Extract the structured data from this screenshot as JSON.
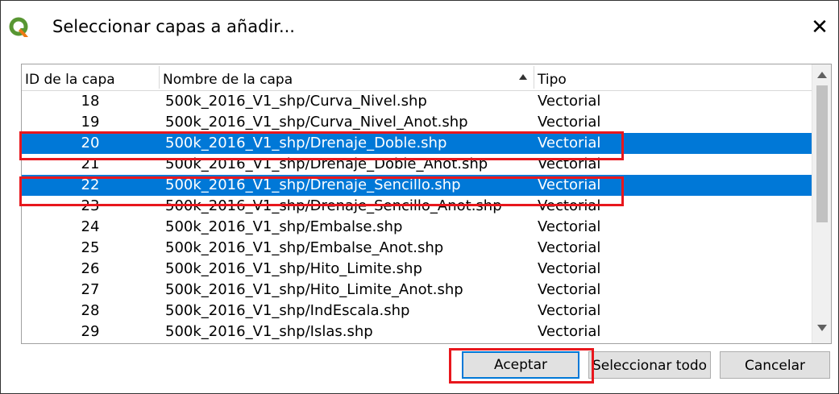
{
  "window": {
    "title": "Seleccionar capas a añadir...",
    "close_glyph": "✕",
    "app_icon": "qgis-logo-icon"
  },
  "columns": {
    "id": "ID de la capa",
    "name": "Nombre de la capa",
    "type": "Tipo",
    "sort_column": "Nombre de la capa",
    "sort_direction": "ascending"
  },
  "rows": [
    {
      "id": "18",
      "name": "500k_2016_V1_shp/Curva_Nivel.shp",
      "type": "Vectorial",
      "selected": false
    },
    {
      "id": "19",
      "name": "500k_2016_V1_shp/Curva_Nivel_Anot.shp",
      "type": "Vectorial",
      "selected": false
    },
    {
      "id": "20",
      "name": "500k_2016_V1_shp/Drenaje_Doble.shp",
      "type": "Vectorial",
      "selected": true
    },
    {
      "id": "21",
      "name": "500k_2016_V1_shp/Drenaje_Doble_Anot.shp",
      "type": "Vectorial",
      "selected": false
    },
    {
      "id": "22",
      "name": "500k_2016_V1_shp/Drenaje_Sencillo.shp",
      "type": "Vectorial",
      "selected": true
    },
    {
      "id": "23",
      "name": "500k_2016_V1_shp/Drenaje_Sencillo_Anot.shp",
      "type": "Vectorial",
      "selected": false
    },
    {
      "id": "24",
      "name": "500k_2016_V1_shp/Embalse.shp",
      "type": "Vectorial",
      "selected": false
    },
    {
      "id": "25",
      "name": "500k_2016_V1_shp/Embalse_Anot.shp",
      "type": "Vectorial",
      "selected": false
    },
    {
      "id": "26",
      "name": "500k_2016_V1_shp/Hito_Limite.shp",
      "type": "Vectorial",
      "selected": false
    },
    {
      "id": "27",
      "name": "500k_2016_V1_shp/Hito_Limite_Anot.shp",
      "type": "Vectorial",
      "selected": false
    },
    {
      "id": "28",
      "name": "500k_2016_V1_shp/IndEscala.shp",
      "type": "Vectorial",
      "selected": false
    },
    {
      "id": "29",
      "name": "500k_2016_V1_shp/Islas.shp",
      "type": "Vectorial",
      "selected": false
    }
  ],
  "buttons": {
    "accept": "Aceptar",
    "select_all": "Seleccionar todo",
    "cancel": "Cancelar"
  },
  "colors": {
    "selection": "#0078d7",
    "highlight": "#e8171d",
    "qgis_green": "#589632",
    "qgis_yellow": "#ee7913"
  }
}
